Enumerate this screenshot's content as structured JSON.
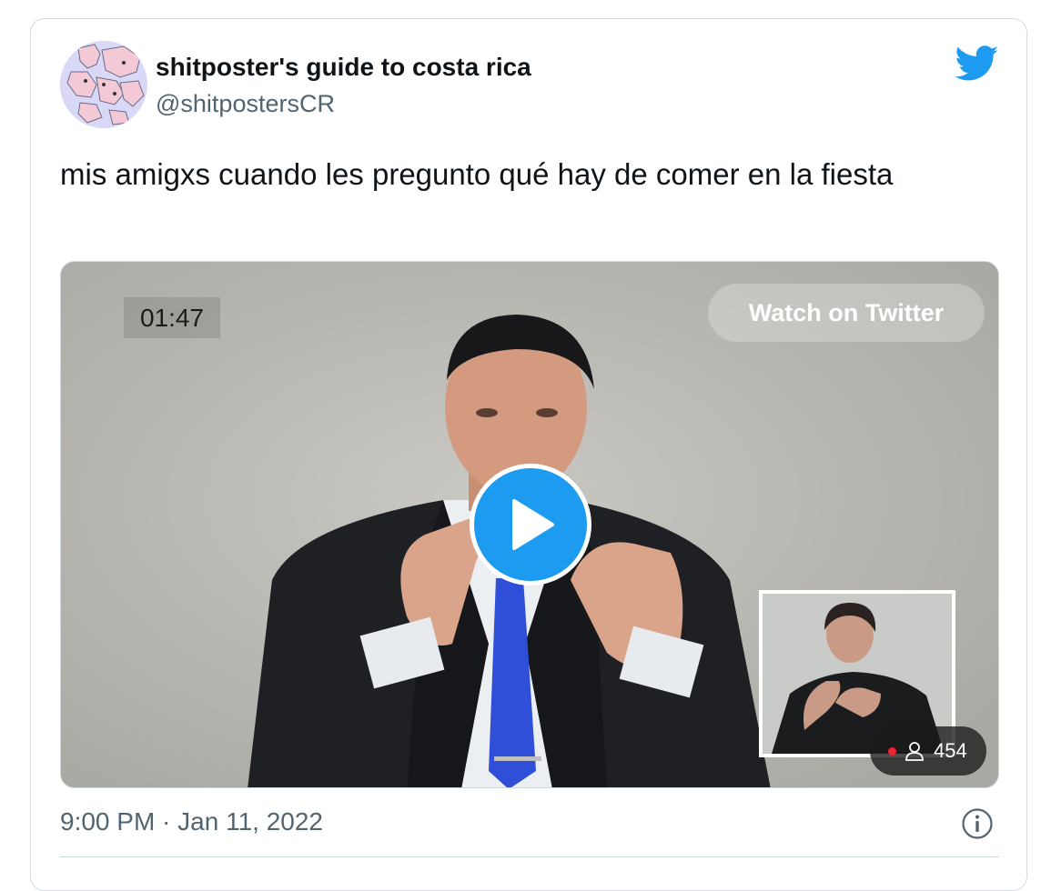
{
  "tweet": {
    "author": {
      "display_name": "shitposter's guide to costa rica",
      "handle": "@shitpostersCR"
    },
    "text": "mis amigxs cuando les pregunto qué hay de comer en la fiesta",
    "timestamp": "9:00 PM · Jan 11, 2022"
  },
  "media": {
    "timer": "01:47",
    "watch_label": "Watch on Twitter",
    "viewer_count": "454"
  },
  "icons": {
    "brand": "twitter-bird-icon",
    "play": "play-icon",
    "info": "info-icon",
    "viewers": "person-icon",
    "live": "live-dot-icon"
  },
  "colors": {
    "brand": "#1d9bf0",
    "text": "#0f1419",
    "secondary": "#536471",
    "tie": "#2f4fd8",
    "live_dot": "#f4212e"
  }
}
